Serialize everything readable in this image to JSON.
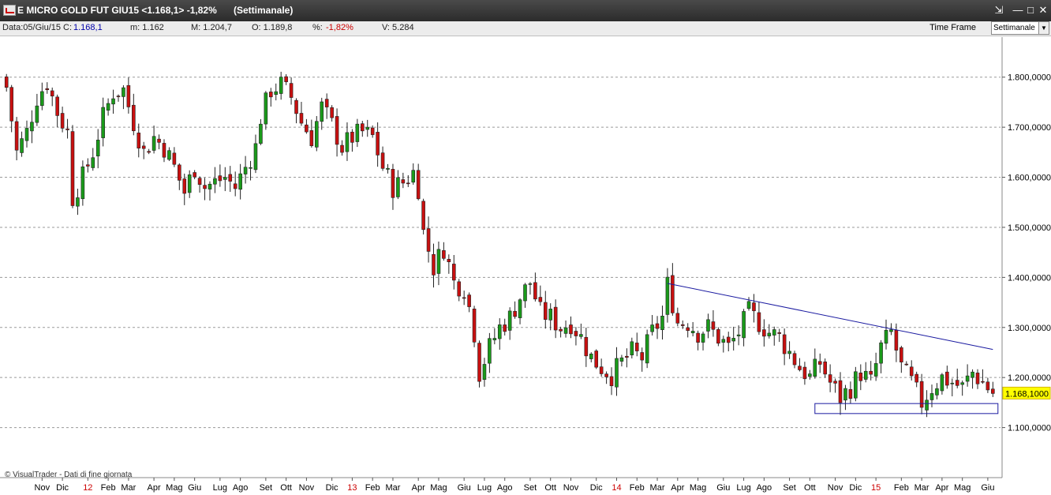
{
  "window": {
    "title": "E MICRO GOLD FUT GIU15 <1.168,1> -1,82%",
    "period": "(Settimanale)",
    "buttons": [
      "⇲",
      "—",
      "□",
      "✕"
    ]
  },
  "info": {
    "data": "Data:05/Giu/15",
    "c_label": "C:",
    "c_value": "1.168,1",
    "m": "m: 1.162",
    "M": "M: 1.204,7",
    "O": "O: 1.189,8",
    "pct_label": "%:",
    "pct_value": "-1,82%",
    "V": "V: 5.284",
    "time_frame_label": "Time Frame",
    "time_frame_value": "Settimanale"
  },
  "credit": "© VisualTrader - Dati di fine giornata",
  "chart_data": {
    "type": "candlestick",
    "ylim": [
      1000,
      1880
    ],
    "yticks": [
      1100,
      1200,
      1300,
      1400,
      1500,
      1600,
      1700,
      1800
    ],
    "ytick_labels": [
      "1.100,0000",
      "1.200,0000",
      "1.300,0000",
      "1.400,0000",
      "1.500,0000",
      "1.600,0000",
      "1.700,0000",
      "1.800,0000"
    ],
    "last_price_label": "1.168,1000",
    "last_price": 1168.1,
    "grid": true,
    "x_labels": [
      {
        "t": 7,
        "text": "Nov",
        "year": false
      },
      {
        "t": 11,
        "text": "Dic",
        "year": false
      },
      {
        "t": 16,
        "text": "12",
        "year": true
      },
      {
        "t": 20,
        "text": "Feb",
        "year": false
      },
      {
        "t": 24,
        "text": "Mar",
        "year": false
      },
      {
        "t": 29,
        "text": "Apr",
        "year": false
      },
      {
        "t": 33,
        "text": "Mag",
        "year": false
      },
      {
        "t": 37,
        "text": "Giu",
        "year": false
      },
      {
        "t": 42,
        "text": "Lug",
        "year": false
      },
      {
        "t": 46,
        "text": "Ago",
        "year": false
      },
      {
        "t": 51,
        "text": "Set",
        "year": false
      },
      {
        "t": 55,
        "text": "Ott",
        "year": false
      },
      {
        "t": 59,
        "text": "Nov",
        "year": false
      },
      {
        "t": 64,
        "text": "Dic",
        "year": false
      },
      {
        "t": 68,
        "text": "13",
        "year": true
      },
      {
        "t": 72,
        "text": "Feb",
        "year": false
      },
      {
        "t": 76,
        "text": "Mar",
        "year": false
      },
      {
        "t": 81,
        "text": "Apr",
        "year": false
      },
      {
        "t": 85,
        "text": "Mag",
        "year": false
      },
      {
        "t": 90,
        "text": "Giu",
        "year": false
      },
      {
        "t": 94,
        "text": "Lug",
        "year": false
      },
      {
        "t": 98,
        "text": "Ago",
        "year": false
      },
      {
        "t": 103,
        "text": "Set",
        "year": false
      },
      {
        "t": 107,
        "text": "Ott",
        "year": false
      },
      {
        "t": 111,
        "text": "Nov",
        "year": false
      },
      {
        "t": 116,
        "text": "Dic",
        "year": false
      },
      {
        "t": 120,
        "text": "14",
        "year": true
      },
      {
        "t": 124,
        "text": "Feb",
        "year": false
      },
      {
        "t": 128,
        "text": "Mar",
        "year": false
      },
      {
        "t": 132,
        "text": "Apr",
        "year": false
      },
      {
        "t": 136,
        "text": "Mag",
        "year": false
      },
      {
        "t": 141,
        "text": "Giu",
        "year": false
      },
      {
        "t": 145,
        "text": "Lug",
        "year": false
      },
      {
        "t": 149,
        "text": "Ago",
        "year": false
      },
      {
        "t": 154,
        "text": "Set",
        "year": false
      },
      {
        "t": 158,
        "text": "Ott",
        "year": false
      },
      {
        "t": 163,
        "text": "Nov",
        "year": false
      },
      {
        "t": 167,
        "text": "Dic",
        "year": false
      },
      {
        "t": 171,
        "text": "15",
        "year": true
      },
      {
        "t": 176,
        "text": "Feb",
        "year": false
      },
      {
        "t": 180,
        "text": "Mar",
        "year": false
      },
      {
        "t": 184,
        "text": "Apr",
        "year": false
      },
      {
        "t": 188,
        "text": "Mag",
        "year": false
      },
      {
        "t": 193,
        "text": "Giu",
        "year": false
      }
    ],
    "trendline": {
      "from": [
        130,
        1388
      ],
      "to": [
        194,
        1256
      ]
    },
    "support_box": {
      "t_start": 159,
      "t_end": 195,
      "y_low": 1128,
      "y_high": 1148
    },
    "close_path": [
      [
        0,
        1780
      ],
      [
        2,
        1650
      ],
      [
        4,
        1690
      ],
      [
        6,
        1760
      ],
      [
        8,
        1790
      ],
      [
        10,
        1730
      ],
      [
        12,
        1690
      ],
      [
        13,
        1560
      ],
      [
        15,
        1600
      ],
      [
        17,
        1650
      ],
      [
        19,
        1720
      ],
      [
        21,
        1770
      ],
      [
        23,
        1775
      ],
      [
        25,
        1710
      ],
      [
        27,
        1650
      ],
      [
        29,
        1680
      ],
      [
        31,
        1660
      ],
      [
        33,
        1620
      ],
      [
        35,
        1570
      ],
      [
        37,
        1620
      ],
      [
        39,
        1580
      ],
      [
        41,
        1590
      ],
      [
        43,
        1600
      ],
      [
        45,
        1580
      ],
      [
        47,
        1620
      ],
      [
        49,
        1660
      ],
      [
        50,
        1720
      ],
      [
        52,
        1775
      ],
      [
        54,
        1785
      ],
      [
        56,
        1760
      ],
      [
        58,
        1710
      ],
      [
        60,
        1680
      ],
      [
        62,
        1740
      ],
      [
        64,
        1705
      ],
      [
        66,
        1660
      ],
      [
        68,
        1680
      ],
      [
        70,
        1690
      ],
      [
        72,
        1680
      ],
      [
        74,
        1620
      ],
      [
        76,
        1580
      ],
      [
        78,
        1590
      ],
      [
        80,
        1610
      ],
      [
        81,
        1580
      ],
      [
        82,
        1490
      ],
      [
        84,
        1420
      ],
      [
        86,
        1460
      ],
      [
        88,
        1390
      ],
      [
        90,
        1380
      ],
      [
        91,
        1340
      ],
      [
        92,
        1290
      ],
      [
        93,
        1210
      ],
      [
        95,
        1260
      ],
      [
        97,
        1300
      ],
      [
        99,
        1320
      ],
      [
        101,
        1360
      ],
      [
        103,
        1390
      ],
      [
        105,
        1330
      ],
      [
        107,
        1320
      ],
      [
        109,
        1300
      ],
      [
        111,
        1310
      ],
      [
        113,
        1280
      ],
      [
        115,
        1240
      ],
      [
        117,
        1220
      ],
      [
        119,
        1205
      ],
      [
        121,
        1230
      ],
      [
        123,
        1250
      ],
      [
        125,
        1240
      ],
      [
        127,
        1290
      ],
      [
        129,
        1320
      ],
      [
        130,
        1385
      ],
      [
        131,
        1350
      ],
      [
        132,
        1310
      ],
      [
        134,
        1310
      ],
      [
        136,
        1290
      ],
      [
        138,
        1300
      ],
      [
        140,
        1280
      ],
      [
        142,
        1260
      ],
      [
        144,
        1290
      ],
      [
        146,
        1330
      ],
      [
        148,
        1310
      ],
      [
        150,
        1290
      ],
      [
        152,
        1280
      ],
      [
        154,
        1250
      ],
      [
        156,
        1220
      ],
      [
        158,
        1200
      ],
      [
        160,
        1230
      ],
      [
        162,
        1190
      ],
      [
        164,
        1160
      ],
      [
        166,
        1180
      ],
      [
        168,
        1210
      ],
      [
        170,
        1190
      ],
      [
        172,
        1260
      ],
      [
        174,
        1290
      ],
      [
        176,
        1220
      ],
      [
        178,
        1190
      ],
      [
        180,
        1150
      ],
      [
        182,
        1180
      ],
      [
        184,
        1200
      ],
      [
        186,
        1190
      ],
      [
        188,
        1180
      ],
      [
        190,
        1210
      ],
      [
        192,
        1190
      ],
      [
        194,
        1168
      ]
    ]
  }
}
